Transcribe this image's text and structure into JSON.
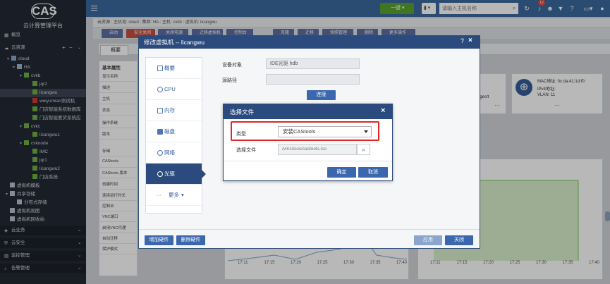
{
  "sidebar": {
    "logo": "CAS",
    "platform_title": "云计算管理平台",
    "items": [
      {
        "label": "概览",
        "level": 0
      },
      {
        "label": "云资源",
        "level": 0
      },
      {
        "label": "cloud",
        "level": 1
      },
      {
        "label": "HA",
        "level": 2
      },
      {
        "label": "cvkb",
        "level": 3
      },
      {
        "label": "jqr2",
        "level": 4
      },
      {
        "label": "licangwu",
        "level": 4
      },
      {
        "label": "weiyumian测试机",
        "level": 4
      },
      {
        "label": "门店智能系统数据库",
        "level": 4
      },
      {
        "label": "门店智能要货系统应",
        "level": 4
      },
      {
        "label": "cvkc",
        "level": 3
      },
      {
        "label": "licangwu1",
        "level": 4
      },
      {
        "label": "cvknode",
        "level": 3
      },
      {
        "label": "IMC",
        "level": 4
      },
      {
        "label": "jqr1",
        "level": 4
      },
      {
        "label": "licangwu2",
        "level": 4
      },
      {
        "label": "门店系统",
        "level": 4
      },
      {
        "label": "虚拟机模板",
        "level": 1
      },
      {
        "label": "共享存储",
        "level": 1
      },
      {
        "label": "分布式存储",
        "level": 2
      },
      {
        "label": "虚拟机视图",
        "level": 1
      },
      {
        "label": "虚拟机回收站",
        "level": 1
      },
      {
        "label": "云业务",
        "level": 0
      },
      {
        "label": "云安全",
        "level": 0
      },
      {
        "label": "监控管理",
        "level": 0
      },
      {
        "label": "告警管理",
        "level": 0
      }
    ],
    "add_symbol": "+",
    "minus_symbol": "−"
  },
  "topbar": {
    "onekey_label": "一键",
    "search_placeholder": "请输入主机名称",
    "alert_count": "12"
  },
  "breadcrumb": "云资源 : 主机池: cloud : 集群: HA : 主机: cvkb : 虚拟机: licangwu",
  "toolbar": {
    "buttons": [
      "启动",
      "安全关闭",
      "关闭电源",
      "迁移虚拟机",
      "控制台",
      "克隆",
      "迁移",
      "快照管理",
      "删除",
      "更多操作"
    ]
  },
  "tabs": {
    "overview": "概要"
  },
  "props": {
    "section": "基本属性",
    "rows": [
      "显示名称",
      "描述",
      "主机",
      "状态",
      "操作系统",
      "版本",
      "存储",
      "CAStools",
      "CAStools 版本",
      "创建时间",
      "连续运行时长",
      "控制台",
      "VNC端口",
      "启用VNC代理",
      "自动迁移",
      "保护模式"
    ]
  },
  "netcard": {
    "mac": "MAC地址: 0c:da:41:1d:f0:",
    "ipv4": "IPv4地址:",
    "vlan": "VLAN:  11"
  },
  "image_panel_text": "ages/t",
  "chart": {
    "x_ticks": [
      "17:11",
      "17:15",
      "17:20",
      "17:25",
      "17:30",
      "17:35",
      "17:40"
    ]
  },
  "modal": {
    "title": "修改虚拟机 -- licangwu",
    "help": "?",
    "close": "×",
    "nav": [
      "概要",
      "CPU",
      "内存",
      "磁盘",
      "网络",
      "光驱",
      "更多"
    ],
    "device_label": "设备对象",
    "device_value": "IDE光驱 hdb",
    "source_label": "源路径",
    "source_value": "",
    "connect_label": "连接",
    "add_hw": "增加硬件",
    "del_hw": "删除硬件",
    "apply": "应用",
    "close_btn": "关闭"
  },
  "file_dialog": {
    "title": "选择文件",
    "close": "×",
    "type_label": "类型",
    "type_value": "安装CAStools",
    "file_label": "选择文件",
    "file_value": "/vms/isos/castools.iso",
    "ok": "确定",
    "cancel": "取消"
  },
  "colors": {
    "header": "#2b4a7e",
    "topbar": "#3c6a9e",
    "highlight": "#e02626",
    "onekey": "#5ba22f"
  }
}
